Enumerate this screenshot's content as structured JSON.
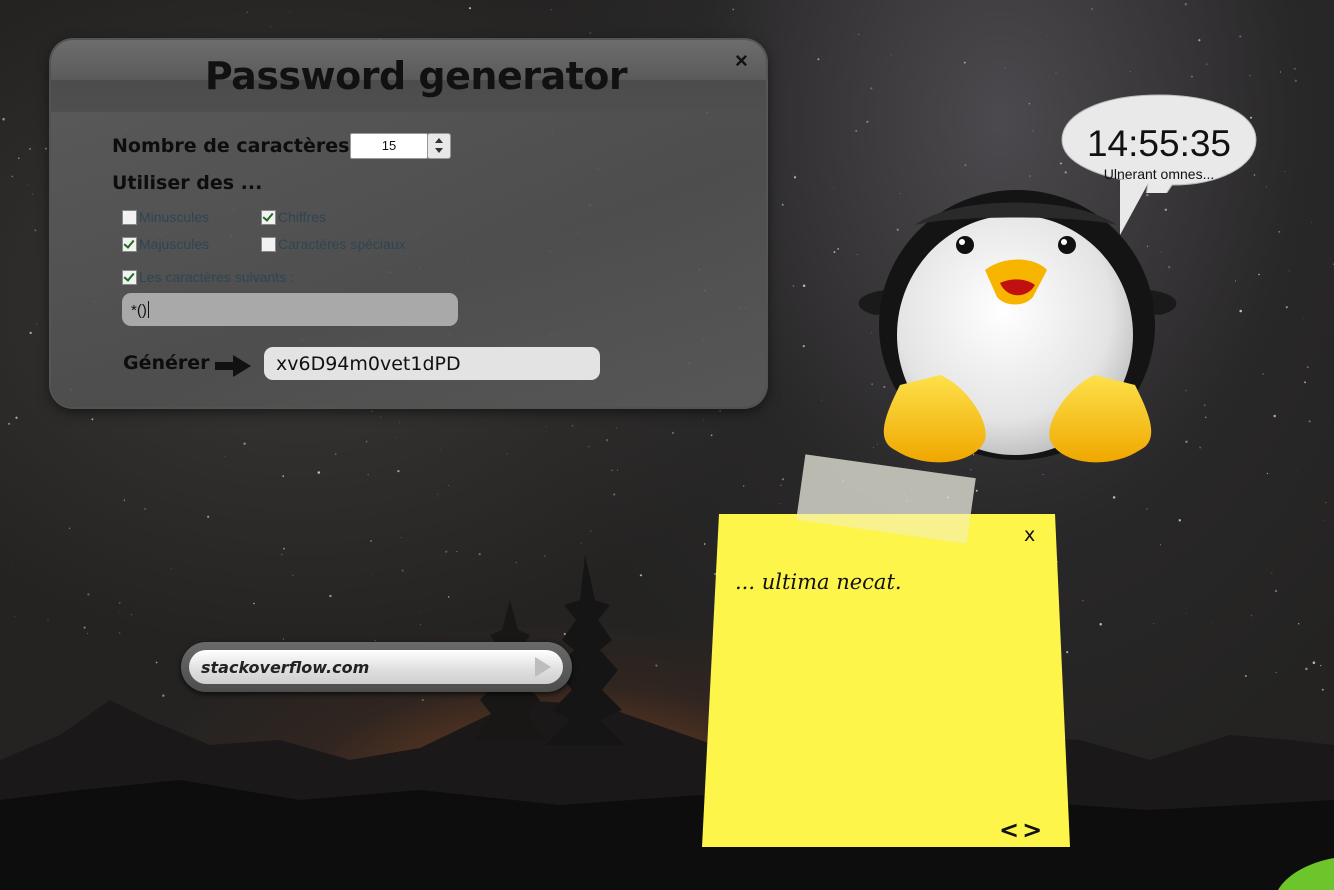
{
  "password_generator": {
    "title": "Password generator",
    "close_label": "×",
    "count_label": "Nombre de caractères :",
    "count_value": "15",
    "use_label": "Utiliser des ...",
    "options": [
      {
        "label": "Minuscules",
        "checked": false
      },
      {
        "label": "Chiffres",
        "checked": true
      },
      {
        "label": "Majuscules",
        "checked": true
      },
      {
        "label": "Caractères spéciaux",
        "checked": false
      },
      {
        "label": "Les caractères suivants :",
        "checked": true
      }
    ],
    "custom_chars_value": "*()",
    "generate_label": "Générer",
    "arrow_icon": "right-arrow-icon",
    "result_value": "xv6D94m0vet1dPD"
  },
  "url_bar": {
    "value": "stackoverflow.com",
    "go_icon": "play-arrow-icon"
  },
  "clock": {
    "time": "14:55:35",
    "caption": "Ulnerant omnes..."
  },
  "sticky_note": {
    "close_label": "x",
    "text": "... ultima necat.",
    "nav_label": "<>"
  },
  "colors": {
    "note_yellow": "#fdf54a",
    "penguin_feet": "#f7c31a",
    "panel_gray": "#5f5f5f"
  }
}
